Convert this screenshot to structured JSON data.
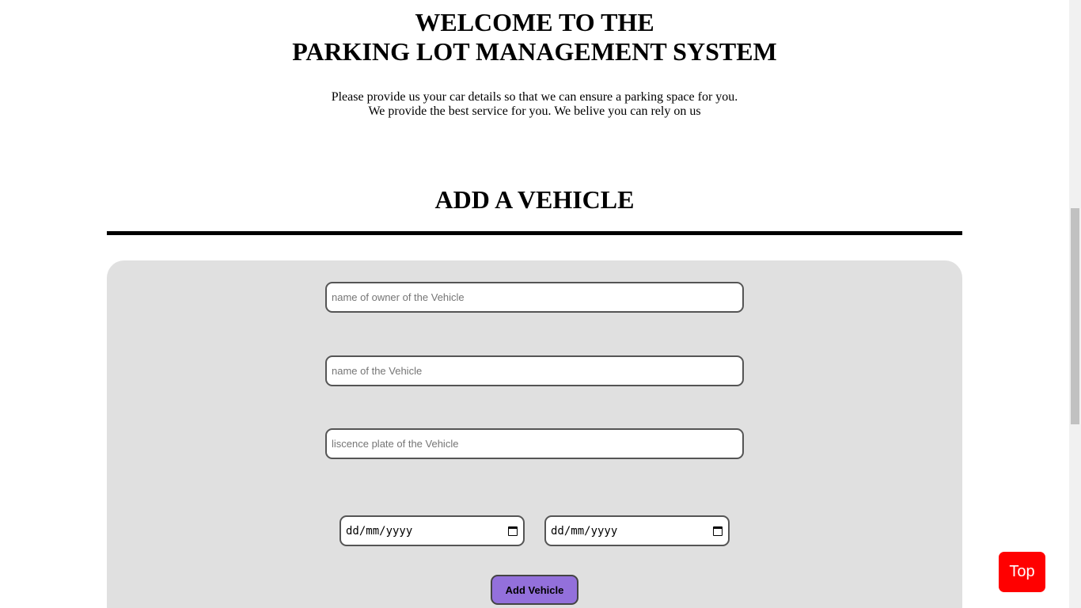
{
  "header": {
    "title_line1": "WELCOME TO THE",
    "title_line2": "PARKING LOT MANAGEMENT SYSTEM",
    "intro_line1": "Please provide us your car details so that we can ensure a parking space for you.",
    "intro_line2": "We provide the best service for you. We belive you can rely on us"
  },
  "section": {
    "heading": "ADD A VEHICLE"
  },
  "form": {
    "owner_placeholder": "name of owner of the Vehicle",
    "vehicle_placeholder": "name of the Vehicle",
    "plate_placeholder": "liscence plate of the Vehicle",
    "start_date_placeholder": "dd/mm/yyyy",
    "end_date_placeholder": "dd/mm/yyyy",
    "submit_label": "Add Vehicle"
  },
  "top_button": {
    "label": "Top"
  },
  "colors": {
    "panel_bg": "#e0e0e0",
    "submit_bg": "#9370db",
    "top_button_bg": "#ff0000"
  },
  "icons": {
    "date_picker": "calendar-icon"
  }
}
